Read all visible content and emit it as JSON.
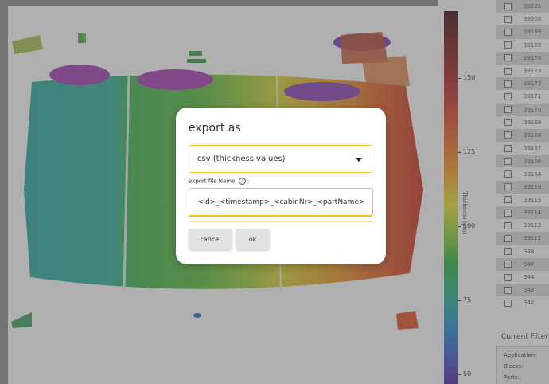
{
  "colors": {
    "accent": "#f2c61b",
    "overlay": "rgba(90,90,90,0.48)",
    "row_alt": "#dcdcdc"
  },
  "colorbar": {
    "title": "Thickness (µm)",
    "ticks": [
      "150",
      "125",
      "100",
      "75",
      "50"
    ]
  },
  "list": {
    "items": [
      "39201",
      "39200",
      "39199",
      "39198",
      "39174",
      "39173",
      "39172",
      "39171",
      "39170",
      "39169",
      "39168",
      "39167",
      "39166",
      "39164",
      "39116",
      "39115",
      "39114",
      "39113",
      "39112",
      "348",
      "347",
      "344",
      "343",
      "342"
    ]
  },
  "filters": {
    "title": "Current Filter",
    "application_label": "Application:",
    "blocks_label": "Blocks:",
    "parts_label": "Parts:"
  },
  "dialog": {
    "title": "export as",
    "format_value": "csv (thickness values)",
    "filename_label": "export file Name",
    "info_icon": "i",
    "filename_label_suffix": ":",
    "filename_value": "<id>_<timestamp>_<cabinNr>_<partName>",
    "cancel_label": "cancel",
    "ok_label": "ok"
  }
}
